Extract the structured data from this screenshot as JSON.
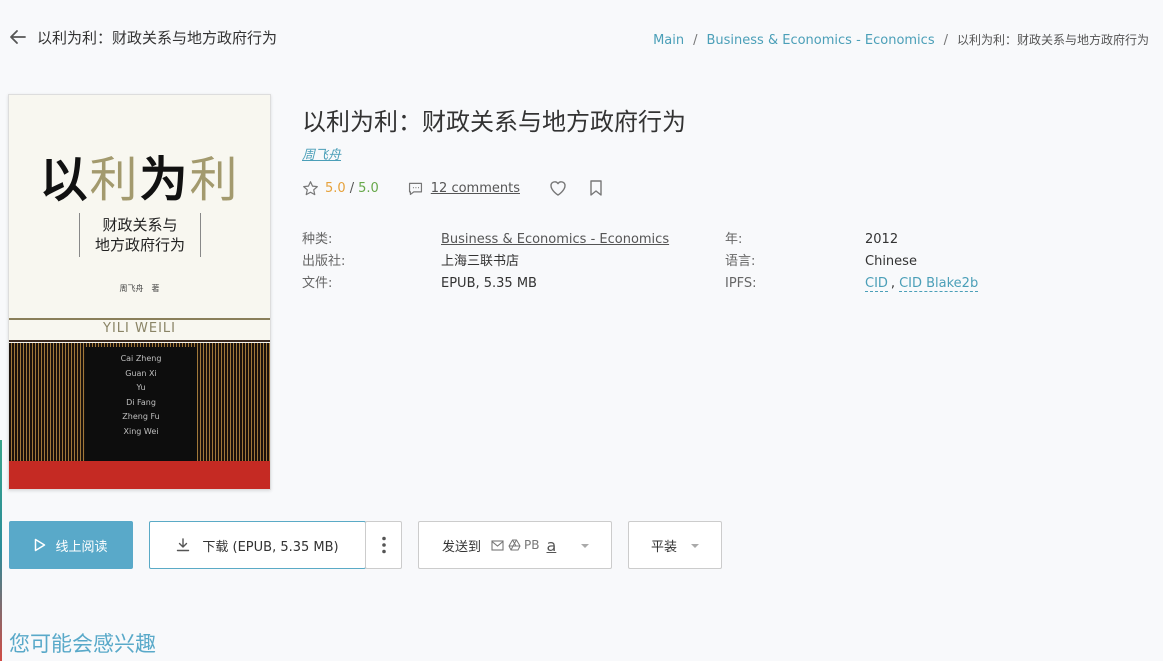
{
  "header": {
    "title": "以利为利：财政关系与地方政府行为",
    "breadcrumb": [
      "Main",
      "Business & Economics - Economics",
      "以利为利：财政关系与地方政府行为"
    ]
  },
  "cover": {
    "title_1": "以",
    "title_2": "利",
    "title_3": "为",
    "title_4": "利",
    "subtitle_1": "财政关系与",
    "subtitle_2": "地方政府行为",
    "author": "周飞舟　著",
    "pinyin": "YILI  WEILI",
    "pinyin_lines": [
      "Cai Zheng",
      "Guan Xi",
      "Yu",
      "Di Fang",
      "Zheng Fu",
      "Xing Wei"
    ]
  },
  "book": {
    "title": "以利为利：财政关系与地方政府行为",
    "author": "周飞舟",
    "rating": "5.0",
    "rating_max": "5.0",
    "comments": "12 comments"
  },
  "details": {
    "category_label": "种类:",
    "category_value": "Business & Economics - Economics",
    "publisher_label": "出版社:",
    "publisher_value": "上海三联书店",
    "file_label": "文件:",
    "file_value": "EPUB, 5.35 MB",
    "year_label": "年:",
    "year_value": "2012",
    "language_label": "语言:",
    "language_value": "Chinese",
    "ipfs_label": "IPFS:",
    "ipfs_cid": "CID",
    "ipfs_sep": ",",
    "ipfs_blake": "CID Blake2b"
  },
  "actions": {
    "read_label": "线上阅读",
    "download_label": "下载 (EPUB, 5.35 MB)",
    "send_label": "发送到",
    "send_pb": "PB",
    "send_amazon": "a",
    "format_label": "平装"
  },
  "section": {
    "suggest_title": "您可能会感兴趣"
  },
  "colors": {
    "accent": "#59a9c9",
    "link": "#4b9fb8",
    "rating_orange": "#e6a23c",
    "rating_green": "#67a84a"
  }
}
